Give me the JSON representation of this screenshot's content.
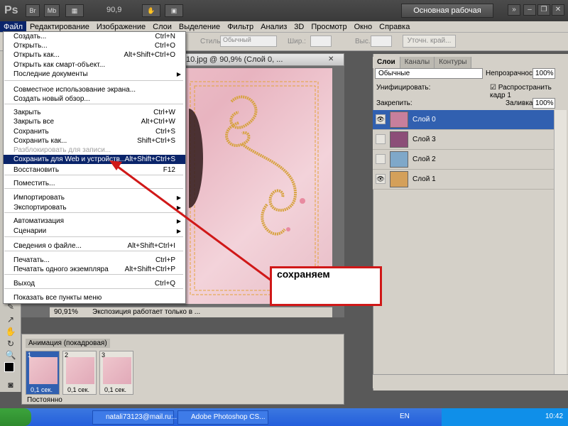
{
  "app": {
    "logo": "Ps",
    "br_label": "Br",
    "mb_label": "Mb",
    "zoom": "90,9",
    "workspace": "Основная рабочая среда"
  },
  "menubar": [
    "Файл",
    "Редактирование",
    "Изображение",
    "Слои",
    "Выделение",
    "Фильтр",
    "Анализ",
    "3D",
    "Просмотр",
    "Окно",
    "Справка"
  ],
  "options": {
    "style_label": "Стиль:",
    "style_value": "Обычный",
    "width_label": "Шир.:",
    "height_label": "Выс.:",
    "refine_edge": "Уточн. край..."
  },
  "file_menu": {
    "items": [
      {
        "label": "Создать...",
        "shortcut": "Ctrl+N"
      },
      {
        "label": "Открыть...",
        "shortcut": "Ctrl+O"
      },
      {
        "label": "Открыть как...",
        "shortcut": "Alt+Shift+Ctrl+O"
      },
      {
        "label": "Открыть как смарт-объект...",
        "shortcut": ""
      },
      {
        "label": "Последние документы",
        "shortcut": "",
        "submenu": true
      },
      {
        "label": "Совместное использование экрана...",
        "shortcut": ""
      },
      {
        "label": "Создать новый обзор...",
        "shortcut": ""
      },
      {
        "label": "Закрыть",
        "shortcut": "Ctrl+W"
      },
      {
        "label": "Закрыть все",
        "shortcut": "Alt+Ctrl+W"
      },
      {
        "label": "Сохранить",
        "shortcut": "Ctrl+S"
      },
      {
        "label": "Сохранить как...",
        "shortcut": "Shift+Ctrl+S"
      },
      {
        "label": "Разблокировать для записи...",
        "shortcut": "",
        "disabled": true
      },
      {
        "label": "Сохранить для Web и устройств...",
        "shortcut": "Alt+Shift+Ctrl+S",
        "highlighted": true
      },
      {
        "label": "Восстановить",
        "shortcut": "F12"
      },
      {
        "label": "Поместить...",
        "shortcut": ""
      },
      {
        "label": "Импортировать",
        "shortcut": "",
        "submenu": true
      },
      {
        "label": "Экспортировать",
        "shortcut": "",
        "submenu": true
      },
      {
        "label": "Автоматизация",
        "shortcut": "",
        "submenu": true
      },
      {
        "label": "Сценарии",
        "shortcut": "",
        "submenu": true
      },
      {
        "label": "Сведения о файле...",
        "shortcut": "Alt+Shift+Ctrl+I"
      },
      {
        "label": "Печатать...",
        "shortcut": "Ctrl+P"
      },
      {
        "label": "Печатать одного экземпляра",
        "shortcut": "Alt+Shift+Ctrl+P"
      },
      {
        "label": "Выход",
        "shortcut": "Ctrl+Q"
      },
      {
        "label": "Показать все пункты меню",
        "shortcut": ""
      }
    ]
  },
  "document": {
    "title": "e-2010.jpg @ 90,9% (Слой 0, ...",
    "zoom": "90,91%",
    "status": "Экспозиция работает только в ..."
  },
  "callout": "сохраняем",
  "layers_panel": {
    "tabs": [
      "Слои",
      "Каналы",
      "Контуры"
    ],
    "blend_mode": "Обычные",
    "opacity_label": "Непрозрачность:",
    "opacity": "100%",
    "unify_label": "Унифицировать:",
    "propagate_label": "Распространить кадр 1",
    "lock_label": "Закрепить:",
    "fill_label": "Заливка:",
    "fill": "100%",
    "layers": [
      {
        "name": "Слой 0",
        "visible": true,
        "selected": true,
        "color": "#c77f9c"
      },
      {
        "name": "Слой 3",
        "visible": false,
        "selected": false,
        "color": "#8c4e78"
      },
      {
        "name": "Слой 2",
        "visible": false,
        "selected": false,
        "color": "#7fa8c9"
      },
      {
        "name": "Слой 1",
        "visible": true,
        "selected": false,
        "color": "#d4a05a"
      }
    ]
  },
  "animation": {
    "tab": "Анимация (покадровая)",
    "frames": [
      {
        "num": "1",
        "delay": "0,1 сек.",
        "selected": true
      },
      {
        "num": "2",
        "delay": "0,1 сек.",
        "selected": false
      },
      {
        "num": "3",
        "delay": "0,1 сек.",
        "selected": false
      }
    ],
    "loop": "Постоянно"
  },
  "taskbar": {
    "email": "natali73123@mail.ru:...",
    "photoshop": "Adobe Photoshop CS...",
    "lang": "EN",
    "clock": "10:42"
  }
}
